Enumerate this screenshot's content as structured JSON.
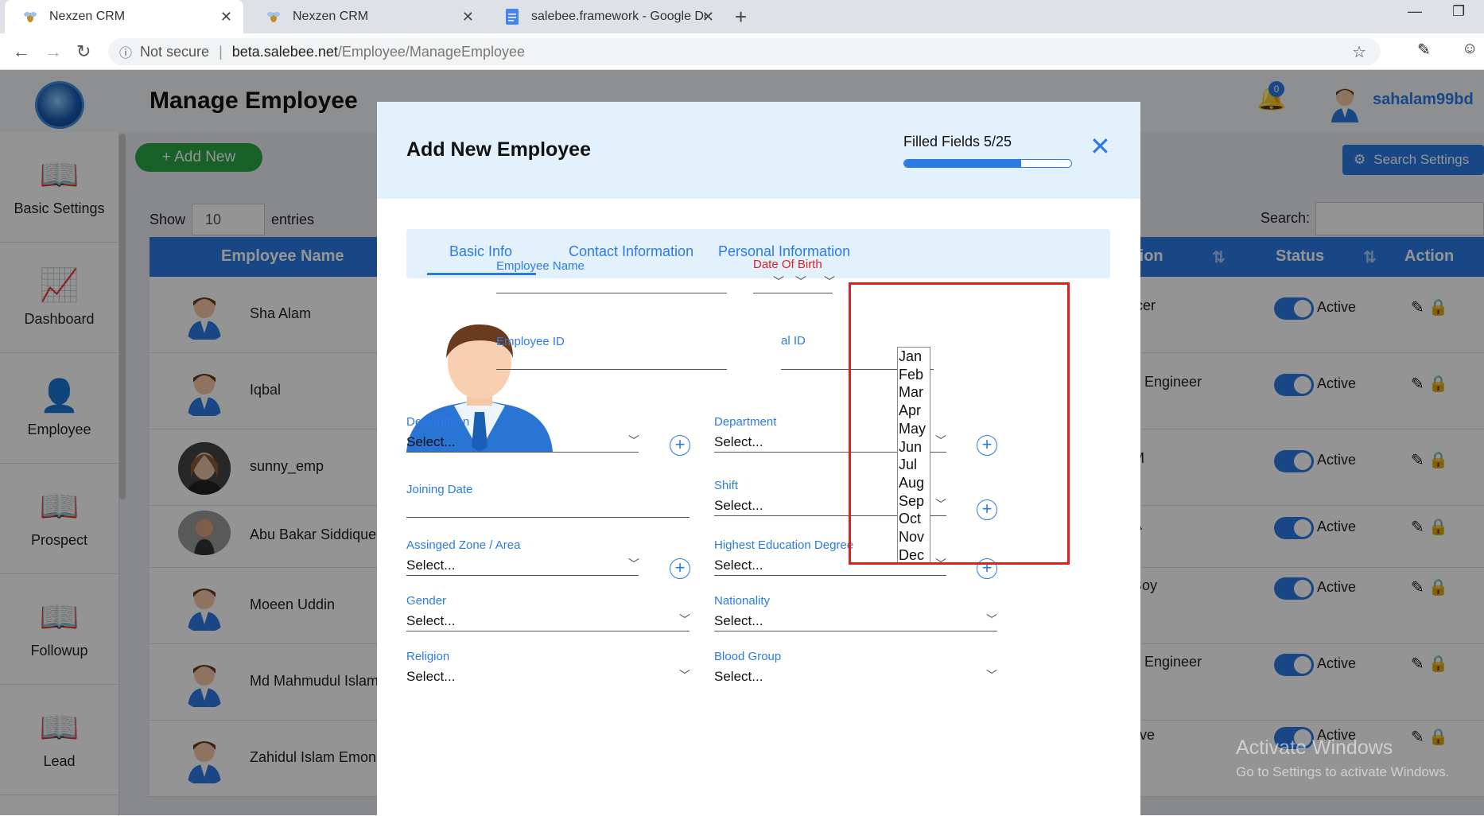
{
  "browser": {
    "tabs": [
      {
        "title": "Nexzen CRM",
        "active": true
      },
      {
        "title": "Nexzen CRM",
        "active": false
      },
      {
        "title": "salebee.framework - Google Doc",
        "active": false
      }
    ],
    "address": {
      "security": "Not secure",
      "host": "beta.salebee.net",
      "path": "/Employee/ManageEmployee"
    }
  },
  "header": {
    "page_title": "Manage Employee",
    "notification_count": "0",
    "username": "sahalam99bd"
  },
  "sidebar": {
    "items": [
      {
        "label": "Basic Settings",
        "icon": "book-icon"
      },
      {
        "label": "Dashboard",
        "icon": "chart-icon"
      },
      {
        "label": "Employee",
        "icon": "user-icon"
      },
      {
        "label": "Prospect",
        "icon": "book-icon"
      },
      {
        "label": "Followup",
        "icon": "book-icon"
      },
      {
        "label": "Lead",
        "icon": "book-icon"
      }
    ]
  },
  "list": {
    "add_new": "+ Add New",
    "show_label": "Show",
    "show_value": "10",
    "entries_label": "entries",
    "search_settings": "Search Settings",
    "search_label": "Search:",
    "columns": {
      "name": "Employee Name",
      "position": "tion",
      "status": "Status",
      "action": "Action"
    },
    "rows": [
      {
        "name": "Sha Alam",
        "position": "icer",
        "status": "Active"
      },
      {
        "name": "Iqbal",
        "position": "e Engineer",
        "status": "Active"
      },
      {
        "name": "sunny_emp",
        "position": "M",
        "status": "Active"
      },
      {
        "name": "Abu Bakar Siddique",
        "position": "A",
        "status": "Active"
      },
      {
        "name": "Moeen Uddin",
        "position": "Boy",
        "status": "Active"
      },
      {
        "name": "Md Mahmudul Islam",
        "position": "e Engineer",
        "status": "Active"
      },
      {
        "name": "Zahidul Islam Emon",
        "position": "tive",
        "status": "Active"
      }
    ]
  },
  "watermark": {
    "line1": "Activate Windows",
    "line2": "Go to Settings to activate Windows."
  },
  "modal": {
    "title": "Add New Employee",
    "filled_fields": "Filled Fields 5/25",
    "progress": 0.7,
    "tabs": [
      "Basic Info",
      "Contact Information",
      "Personal Information"
    ],
    "fields": {
      "employee_name": "Employee Name",
      "date_of_birth": "Date Of Birth",
      "employee_id": "Employee ID",
      "national_id_partial": "al ID",
      "designation": "Designation",
      "department": "Department",
      "joining_date": "Joining Date",
      "shift": "Shift",
      "zone": "Assinged Zone / Area",
      "education": "Highest Education Degree",
      "gender": "Gender",
      "nationality": "Nationality",
      "religion": "Religion",
      "blood_group": "Blood Group",
      "select_placeholder": "Select..."
    },
    "months": [
      "Jan",
      "Feb",
      "Mar",
      "Apr",
      "May",
      "Jun",
      "Jul",
      "Aug",
      "Sep",
      "Oct",
      "Nov",
      "Dec"
    ]
  },
  "colors": {
    "accent": "#2c7be5",
    "highlight": "#e02020",
    "add_button": "#28a745"
  }
}
